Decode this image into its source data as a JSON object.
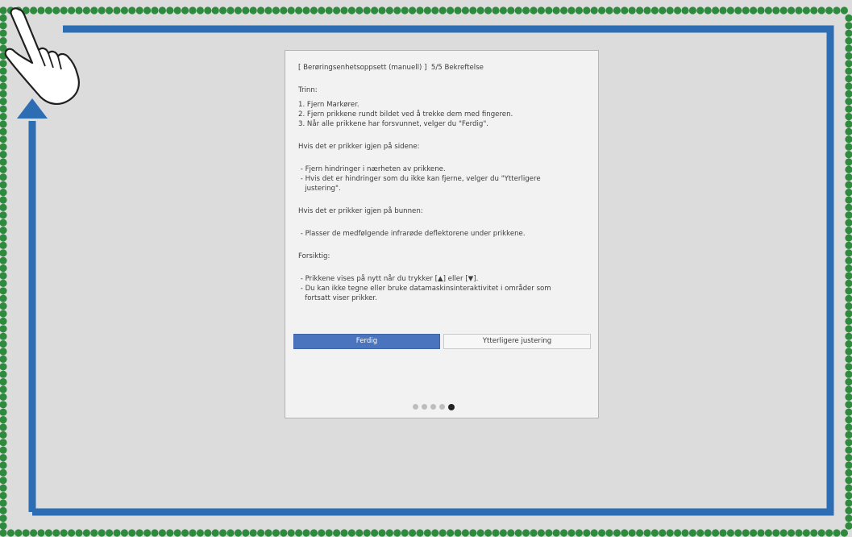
{
  "colors": {
    "screen_bg": "#dcdcdc",
    "dots": "#2e8b3e",
    "arrow": "#2d6db3",
    "primary_button": "#4a74bd"
  },
  "icons": {
    "hand": "pointing-hand-icon",
    "arrow": "clockwise-arrow-icon"
  },
  "dialog": {
    "title": "[ Berøringsenhetsoppsett (manuell) ]  5/5 Bekreftelse",
    "steps_heading": "Trinn:",
    "steps": [
      "1. Fjern Markører.",
      "2. Fjern prikkene rundt bildet ved å trekke dem med fingeren.",
      "3. Når alle prikkene har forsvunnet, velger du \"Ferdig\"."
    ],
    "sides_heading": "Hvis det er prikker igjen på sidene:",
    "sides_items": [
      " - Fjern hindringer i nærheten av prikkene.",
      " - Hvis det er hindringer som du ikke kan fjerne, velger du \"Ytterligere\n   justering\"."
    ],
    "bottom_heading": "Hvis det er prikker igjen på bunnen:",
    "bottom_items": [
      " - Plasser de medfølgende infrarøde deflektorene under prikkene."
    ],
    "caution_heading": "Forsiktig:",
    "caution_items": [
      " - Prikkene vises på nytt når du trykker [▲] eller [▼].",
      " - Du kan ikke tegne eller bruke datamaskinsinteraktivitet i områder som\n   fortsatt viser prikker."
    ],
    "done_button": "Ferdig",
    "more_button": "Ytterligere justering",
    "page_current": 5,
    "page_total": 5
  }
}
